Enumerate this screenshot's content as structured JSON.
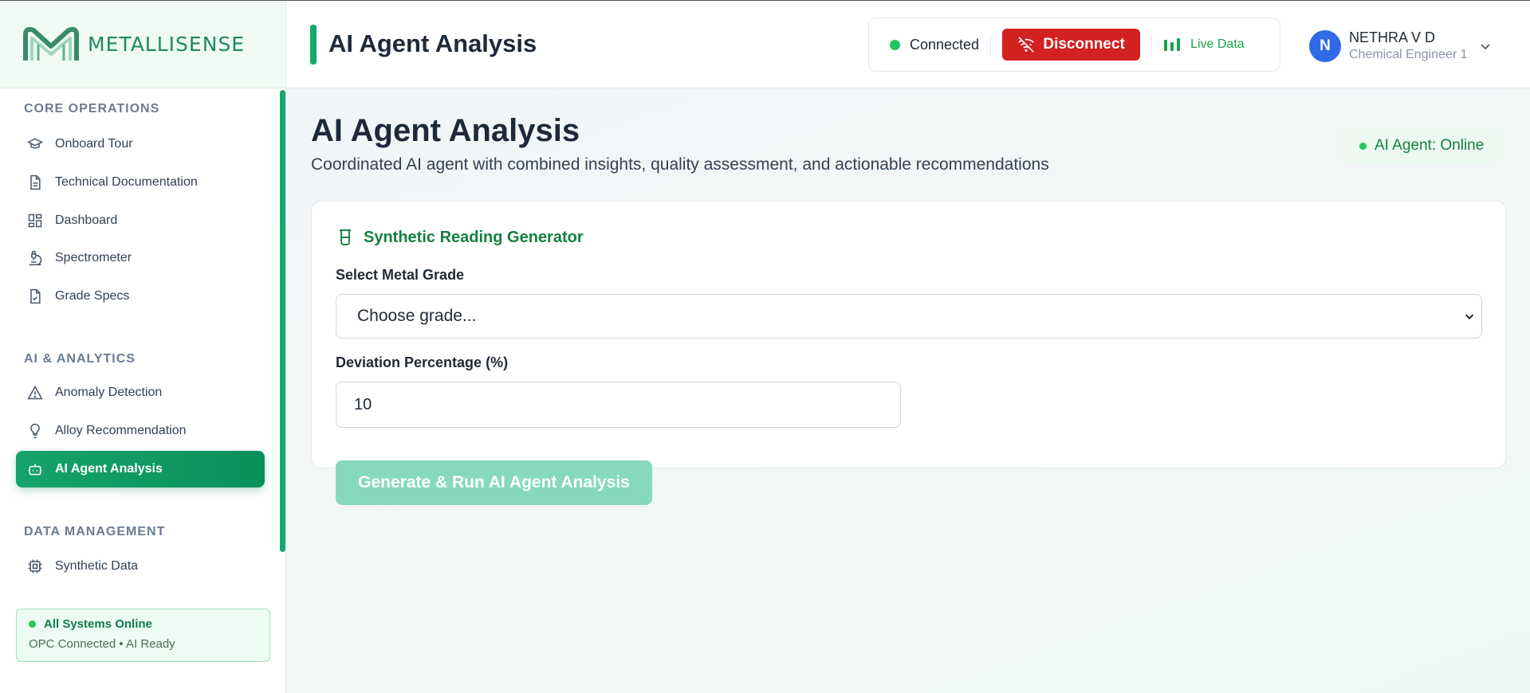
{
  "brand": {
    "name": "METALLISENSE"
  },
  "sidebar": {
    "sections": [
      {
        "title": "CORE OPERATIONS"
      },
      {
        "title": "AI & ANALYTICS"
      },
      {
        "title": "DATA MANAGEMENT"
      }
    ],
    "items": [
      {
        "label": "Onboard Tour",
        "icon": "graduation-cap-icon"
      },
      {
        "label": "Technical Documentation",
        "icon": "document-icon"
      },
      {
        "label": "Dashboard",
        "icon": "dashboard-grid-icon"
      },
      {
        "label": "Spectrometer",
        "icon": "microscope-icon"
      },
      {
        "label": "Grade Specs",
        "icon": "file-check-icon"
      },
      {
        "label": "Anomaly Detection",
        "icon": "warning-triangle-icon"
      },
      {
        "label": "Alloy Recommendation",
        "icon": "lightbulb-icon"
      },
      {
        "label": "AI Agent Analysis",
        "icon": "robot-icon",
        "active": true
      },
      {
        "label": "Synthetic Data",
        "icon": "chip-icon"
      }
    ],
    "system_status": {
      "title": "All Systems Online",
      "detail": "OPC Connected • AI Ready"
    }
  },
  "header": {
    "title": "AI Agent Analysis",
    "connection_status": "Connected",
    "disconnect_label": "Disconnect",
    "live_data_label": "Live Data",
    "user": {
      "initial": "N",
      "name": "NETHRA V D",
      "role": "Chemical Engineer 1"
    }
  },
  "main": {
    "title": "AI Agent Analysis",
    "subtitle": "Coordinated AI agent with combined insights, quality assessment, and actionable recommendations",
    "agent_status": "AI Agent: Online",
    "card": {
      "title": "Synthetic Reading Generator",
      "grade_label": "Select Metal Grade",
      "grade_selected": "Choose grade...",
      "deviation_label": "Deviation Percentage (%)",
      "deviation_value": "10",
      "generate_label": "Generate & Run AI Agent Analysis"
    }
  },
  "colors": {
    "accent": "#14a86a",
    "danger": "#d32020",
    "avatar": "#2f6be6"
  }
}
